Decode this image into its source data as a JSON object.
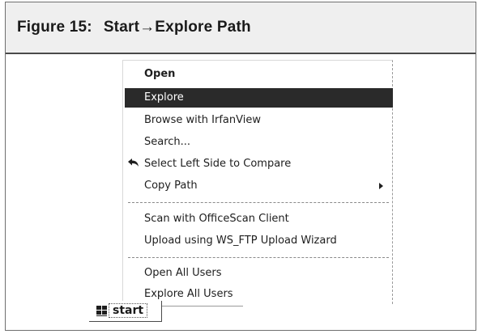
{
  "figure": {
    "number": "Figure 15:",
    "caption": "Start→Explore Path"
  },
  "context_menu": {
    "items": [
      {
        "label": "Open",
        "bold": true
      },
      {
        "label": "Explore",
        "selected": true
      },
      {
        "label": "Browse with IrfanView"
      },
      {
        "label": "Search..."
      },
      {
        "label": "Select Left Side to Compare",
        "icon": "undo-arrow-icon"
      },
      {
        "label": "Copy Path",
        "submenu": true
      },
      {
        "label": "Scan with OfficeScan Client"
      },
      {
        "label": "Upload using WS_FTP Upload Wizard"
      },
      {
        "label": "Open All Users"
      },
      {
        "label": "Explore All Users"
      }
    ]
  },
  "taskbar": {
    "start_label": "start",
    "start_icon": "windows-flag-icon"
  }
}
